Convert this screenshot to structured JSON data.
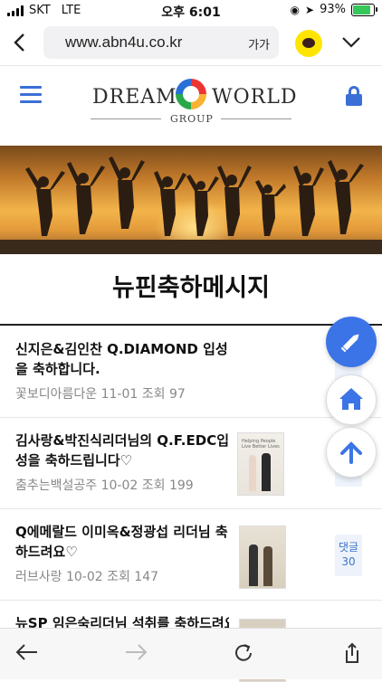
{
  "status_bar": {
    "carrier": "SKT",
    "network": "LTE",
    "time": "오후 6:01",
    "battery": "93%",
    "battery_level": 0.93
  },
  "browser": {
    "url": "www.abn4u.co.kr",
    "text_size_label": "가가"
  },
  "logo": {
    "word_left": "DREAM",
    "word_right": "WORLD",
    "sub": "GROUP"
  },
  "page": {
    "title": "뉴핀축하메시지"
  },
  "posts": [
    {
      "title": "신지은&김인찬 Q.DIAMOND 입성을 축하합니다.",
      "author": "꽃보디아름다운",
      "date": "11-01",
      "views_label": "조회",
      "views": "97",
      "meta": "꽃보디아름다운 11-01 조회 97",
      "comment_label": "",
      "comment_count": ""
    },
    {
      "title": "김사랑&박진식리더님의 Q.F.EDC입성을 축하드립니다♡",
      "author": "춤추는백설공주",
      "date": "10-02",
      "views_label": "조회",
      "views": "199",
      "meta": "춤추는백설공주 10-02 조회 199",
      "thumb_caption": "Helping People Live Better Lives"
    },
    {
      "title": "Q에메랄드 이미옥&정광섭 리더님 축하드려요♡",
      "author": "러브사랑",
      "date": "10-02",
      "views_label": "조회",
      "views": "147",
      "meta": "러브사랑 10-02 조회 147",
      "comment_label": "댓글",
      "comment_count": "30"
    },
    {
      "title": "뉴SP 임은숙리더님 석취를 축하드려요♡",
      "meta": ""
    }
  ],
  "colors": {
    "accent": "#3b74e6",
    "nav_blue": "#3b6fd6",
    "comment_text": "#3b74c9"
  }
}
